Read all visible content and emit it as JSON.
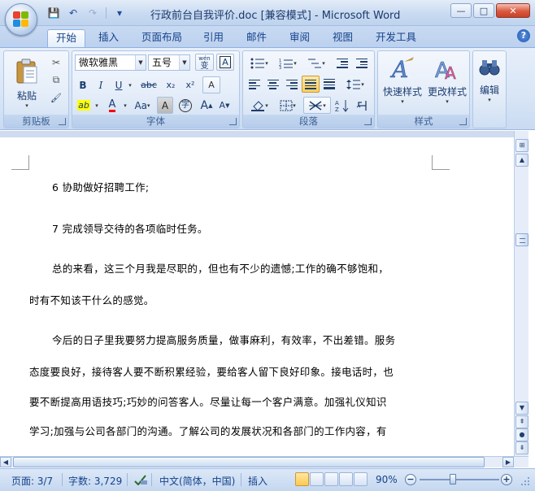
{
  "window": {
    "title": "行政前台自我评价.doc [兼容模式] - Microsoft Word",
    "min": "—",
    "max": "□",
    "close": "✕"
  },
  "qat": {
    "save": "💾",
    "undo": "↶",
    "redo": "↷",
    "more": "▾"
  },
  "tabs": [
    {
      "label": "开始",
      "active": true
    },
    {
      "label": "插入"
    },
    {
      "label": "页面布局"
    },
    {
      "label": "引用"
    },
    {
      "label": "邮件"
    },
    {
      "label": "审阅"
    },
    {
      "label": "视图"
    },
    {
      "label": "开发工具"
    }
  ],
  "help": "?",
  "ribbon": {
    "clipboard": {
      "label": "剪贴板",
      "paste": "粘贴",
      "cut_icon": "✂",
      "copy_icon": "⧉",
      "format_painter_icon": "🖌"
    },
    "font": {
      "label": "字体",
      "font_name": "微软雅黑",
      "font_size": "五号",
      "wen_label": "wén",
      "wen_char": "变",
      "char_border": "A",
      "bold": "B",
      "italic": "I",
      "underline": "U",
      "strike": "abc",
      "subscript": "x₂",
      "superscript": "x²",
      "clear_format": "A",
      "highlight": "ab",
      "font_color": "A",
      "change_case": "Aa",
      "char_shading": "A",
      "enclose": "字",
      "grow": "A",
      "shrink": "A"
    },
    "paragraph": {
      "label": "段落"
    },
    "styles": {
      "label": "样式",
      "quick_styles": "快速样式",
      "change_styles": "更改样式"
    },
    "editing": {
      "label": "编辑"
    }
  },
  "document": {
    "lines": [
      "6  协助做好招聘工作;",
      "7  完成领导交待的各项临时任务。",
      "总的来看，这三个月我是尽职的，但也有不少的遗憾;工作的确不够饱和，",
      "时有不知该干什么的感觉。",
      "今后的日子里我要努力提高服务质量，做事麻利，有效率，不出差错。服务",
      "态度要良好，接待客人要不断积累经验，要给客人留下良好印象。接电话时，也",
      "要不断提高用语技巧;巧妙的问答客人。尽量让每一个客户满意。加强礼仪知识",
      "学习;加强与公司各部门的沟通。了解公司的发展状况和各部门的工作内容，有"
    ]
  },
  "status": {
    "page": "页面: 3/7",
    "words": "字数: 3,729",
    "language": "中文(简体，中国)",
    "mode": "插入",
    "zoom": "90%",
    "zoom_level_percent": 90
  },
  "colors": {
    "highlight": "#ffff00",
    "font_color": "#ff0000",
    "accent": "#15428b"
  }
}
